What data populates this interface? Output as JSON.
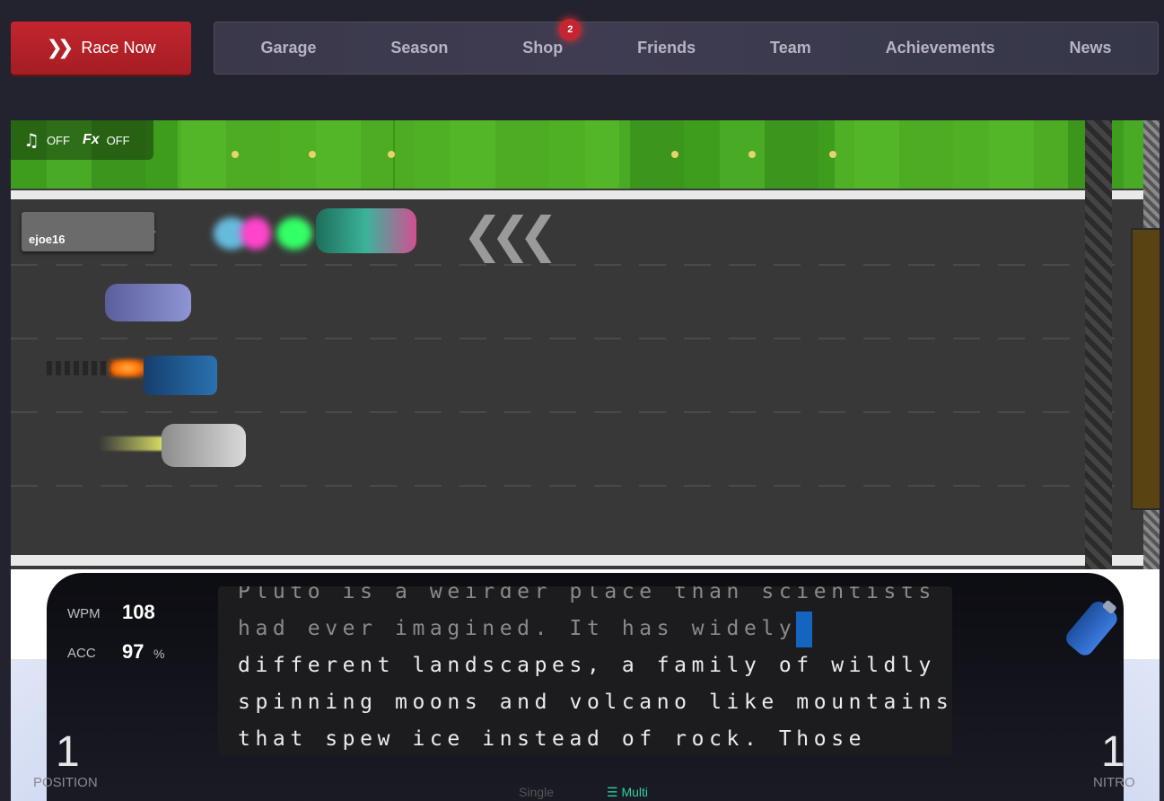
{
  "header": {
    "race_button": "Race Now",
    "nav": [
      {
        "label": "Garage"
      },
      {
        "label": "Season"
      },
      {
        "label": "Shop",
        "badge": "2"
      },
      {
        "label": "Friends"
      },
      {
        "label": "Team"
      },
      {
        "label": "Achievements"
      },
      {
        "label": "News"
      }
    ]
  },
  "sound": {
    "music_label": "OFF",
    "fx_label": "OFF",
    "fx_icon_text": "Fx"
  },
  "player": {
    "name": "ejoe16"
  },
  "dashboard": {
    "wpm_label": "WPM",
    "wpm_value": "108",
    "acc_label": "ACC",
    "acc_value": "97",
    "acc_unit": "%",
    "position_value": "1",
    "position_label": "POSITION",
    "nitro_value": "1",
    "nitro_label": "NITRO",
    "text_line_0": "Pluto is a weirder place than scientists",
    "text_typed": "had ever imagined. It has widely",
    "text_line_2": "different landscapes, a family of wildly",
    "text_line_3": "spinning moons and volcano like mountains",
    "text_line_4": "that spew ice instead of rock. Those",
    "mode_single": "Single",
    "mode_multi": "Multi"
  },
  "colors": {
    "accent": "#c3252d",
    "cursor": "#1565c0",
    "multi": "#2ed39b"
  }
}
